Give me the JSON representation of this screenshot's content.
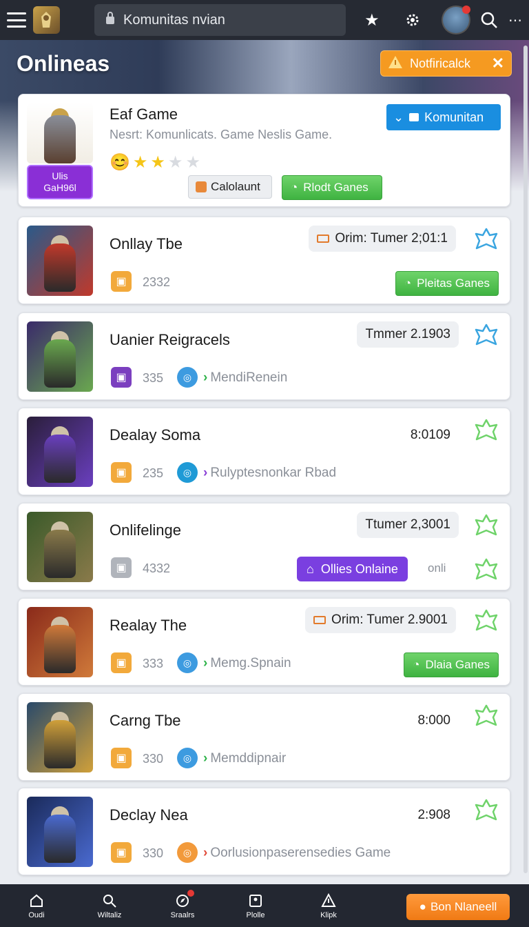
{
  "topbar": {
    "search_text": "Komunitas nvian",
    "icons": [
      "menu-icon",
      "game-logo",
      "lock-icon",
      "star-icon",
      "gear-icon",
      "avatar",
      "search-icon",
      "more-icon"
    ]
  },
  "hero": {
    "title": "Onlineas",
    "notification_label": "Notfiricalck",
    "close_glyph": "✕"
  },
  "featured": {
    "title": "Eaf Game",
    "subtitle": "Nesrt: Komunlicats. Game Neslis Game.",
    "badge_line1": "Ulis",
    "badge_line2": "GaH96l",
    "rating": 2,
    "rating_max": 4,
    "follow_label": "Komunitan",
    "calc_label": "Calolaunt",
    "play_label": "Rlodt Ganes"
  },
  "games": [
    {
      "title": "Onllay Tbe",
      "count": "2332",
      "timer": "Orim: Tumer 2;01:1",
      "timer_style": "boxed-icon",
      "button": "Pleitas Ganes",
      "button_style": "green",
      "meta": "",
      "thumb": [
        "#2a5a8a",
        "#c0392b"
      ],
      "count_color": "#f2a93b"
    },
    {
      "title": "Uanier Reigracels",
      "count": "335",
      "timer": "Tmmer 2.1903",
      "timer_style": "boxed",
      "meta": "MendiRenein",
      "meta_chev_color": "#2fb34a",
      "meta_icon_color": "#3d9be0",
      "thumb": [
        "#3a2a6a",
        "#6aa84f"
      ],
      "count_color": "#7b3fbf"
    },
    {
      "title": "Dealay Soma",
      "count": "235",
      "timer": "8:0109",
      "timer_style": "plain",
      "meta": "Rulyptesnonkar Rbad",
      "meta_chev_color": "#8a3fd6",
      "meta_icon_color": "#1f9ad6",
      "thumb": [
        "#2a1e3a",
        "#6a3fbf"
      ],
      "count_color": "#f2a93b"
    },
    {
      "title": "Onlifelinge",
      "count": "4332",
      "timer": "Ttumer 2,3001",
      "timer_style": "boxed",
      "meta": "",
      "button": "Ollies Onlaine",
      "button_style": "purple",
      "extra": "onli",
      "thumb": [
        "#3a5a2a",
        "#8a7a4a"
      ],
      "count_color": "#b0b4bb"
    },
    {
      "title": "Realay The",
      "count": "333",
      "timer": "Orim: Tumer 2.9001",
      "timer_style": "boxed-icon",
      "meta": "Memg.Spnain",
      "meta_chev_color": "#2fb34a",
      "meta_icon_color": "#3d9be0",
      "button": "Dlaia Ganes",
      "button_style": "green",
      "thumb": [
        "#8a2a1a",
        "#d07a3a"
      ],
      "count_color": "#f2a93b"
    },
    {
      "title": "Carng Tbe",
      "count": "330",
      "timer": "8:000",
      "timer_style": "plain",
      "meta": "Memddipnair",
      "meta_chev_color": "#2fb34a",
      "meta_icon_color": "#3d9be0",
      "thumb": [
        "#2a4a6a",
        "#d0a03a"
      ],
      "count_color": "#f2a93b"
    },
    {
      "title": "Declay Nea",
      "count": "330",
      "timer": "2:908",
      "timer_style": "plain",
      "meta": "Oorlusionpaserensedies Game",
      "meta_chev_color": "#e04a3a",
      "meta_icon_color": "#f29a3b",
      "thumb": [
        "#1a2a5a",
        "#4a6ad0"
      ],
      "count_color": "#f2a93b"
    }
  ],
  "bottomnav": {
    "items": [
      "Oudi",
      "Wiltaliz",
      "Sraalrs",
      "Plolle",
      "Klipk"
    ],
    "cta": "Bon Nlaneell"
  }
}
